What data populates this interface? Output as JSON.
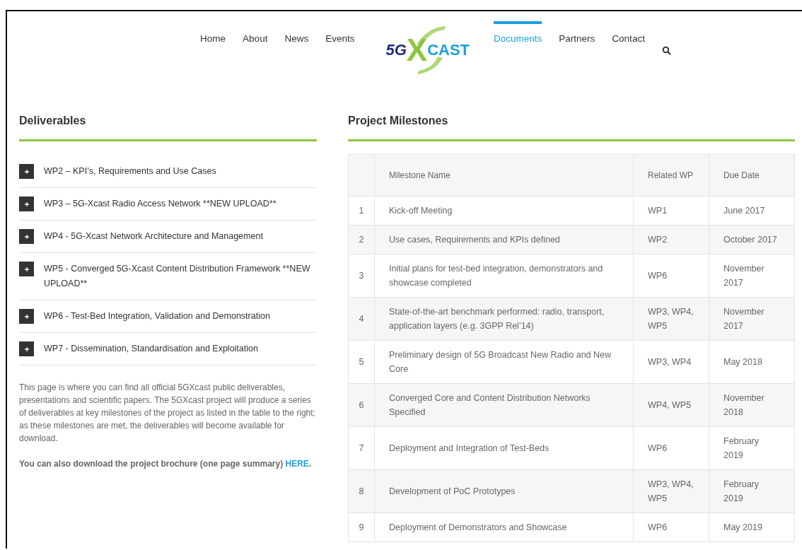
{
  "nav": {
    "left": [
      {
        "label": "Home",
        "selected": false
      },
      {
        "label": "About",
        "selected": false
      },
      {
        "label": "News",
        "selected": false
      },
      {
        "label": "Events",
        "selected": false
      }
    ],
    "logo": {
      "prefix": "5G",
      "mark": "X",
      "suffix": "CAST"
    },
    "right": [
      {
        "label": "Documents",
        "selected": true
      },
      {
        "label": "Partners",
        "selected": false
      },
      {
        "label": "Contact",
        "selected": false
      }
    ]
  },
  "deliverables": {
    "title": "Deliverables",
    "items": [
      {
        "label": "WP2 – KPI’s, Requirements and Use Cases",
        "expanded": false
      },
      {
        "label": "WP3 – 5G-Xcast Radio Access Network **NEW UPLOAD**",
        "expanded": false
      },
      {
        "label": "WP4 - 5G-Xcast Network Architecture and Management",
        "expanded": false
      },
      {
        "label": "WP5 - Converged 5G-Xcast Content Distribution Framework **NEW UPLOAD**",
        "expanded": false
      },
      {
        "label": "WP6 - Test-Bed Integration, Validation and Demonstration",
        "expanded": false
      },
      {
        "label": "WP7 - Dissemination, Standardisation and Exploitation",
        "expanded": false
      }
    ],
    "intro": "This page is where you can find all official 5GXcast public deliverables, presentations and scientific papers. The 5GXcast project will produce a series of deliverables at key milestones of the project as listed in the table to the right; as these milestones are met, the deliverables will become available for download.",
    "brochure": "You can also download the project brochure (one page summary)",
    "brochure_link": "HERE",
    "brochure_end": "."
  },
  "milestones": {
    "title": "Project Milestones",
    "columns": [
      "Milestone Name",
      "Related WP",
      "Due Date"
    ],
    "rows": [
      {
        "number": "1",
        "name": "Kick-off Meeting",
        "wp": "WP1",
        "due": "June 2017"
      },
      {
        "number": "2",
        "name": "Use cases, Requirements and KPIs defined",
        "wp": "WP2",
        "due": "October 2017"
      },
      {
        "number": "3",
        "name": "Initial plans for test-bed integration, demonstrators and showcase completed",
        "wp": "WP6",
        "due": "November 2017"
      },
      {
        "number": "4",
        "name": "State-of-the-art benchmark performed: radio, transport, application layers (e.g. 3GPP Rel’14)",
        "wp": "WP3, WP4, WP5",
        "due": "November 2017"
      },
      {
        "number": "5",
        "name": "Preliminary design of 5G Broadcast New Radio and New Core",
        "wp": "WP3, WP4",
        "due": "May 2018"
      },
      {
        "number": "6",
        "name": "Converged Core and Content Distribution Networks Specified",
        "wp": "WP4, WP5",
        "due": "November 2018"
      },
      {
        "number": "7",
        "name": "Deployment and Integration of Test-Beds",
        "wp": "WP6",
        "due": "February 2019"
      },
      {
        "number": "8",
        "name": " Development of PoC Prototypes",
        "wp": "WP3, WP4, WP5",
        "due": "February 2019"
      },
      {
        "number": "9",
        "name": " Deployment of Demonstrators and Showcase",
        "wp": "WP6",
        "due": "May 2019"
      }
    ]
  }
}
